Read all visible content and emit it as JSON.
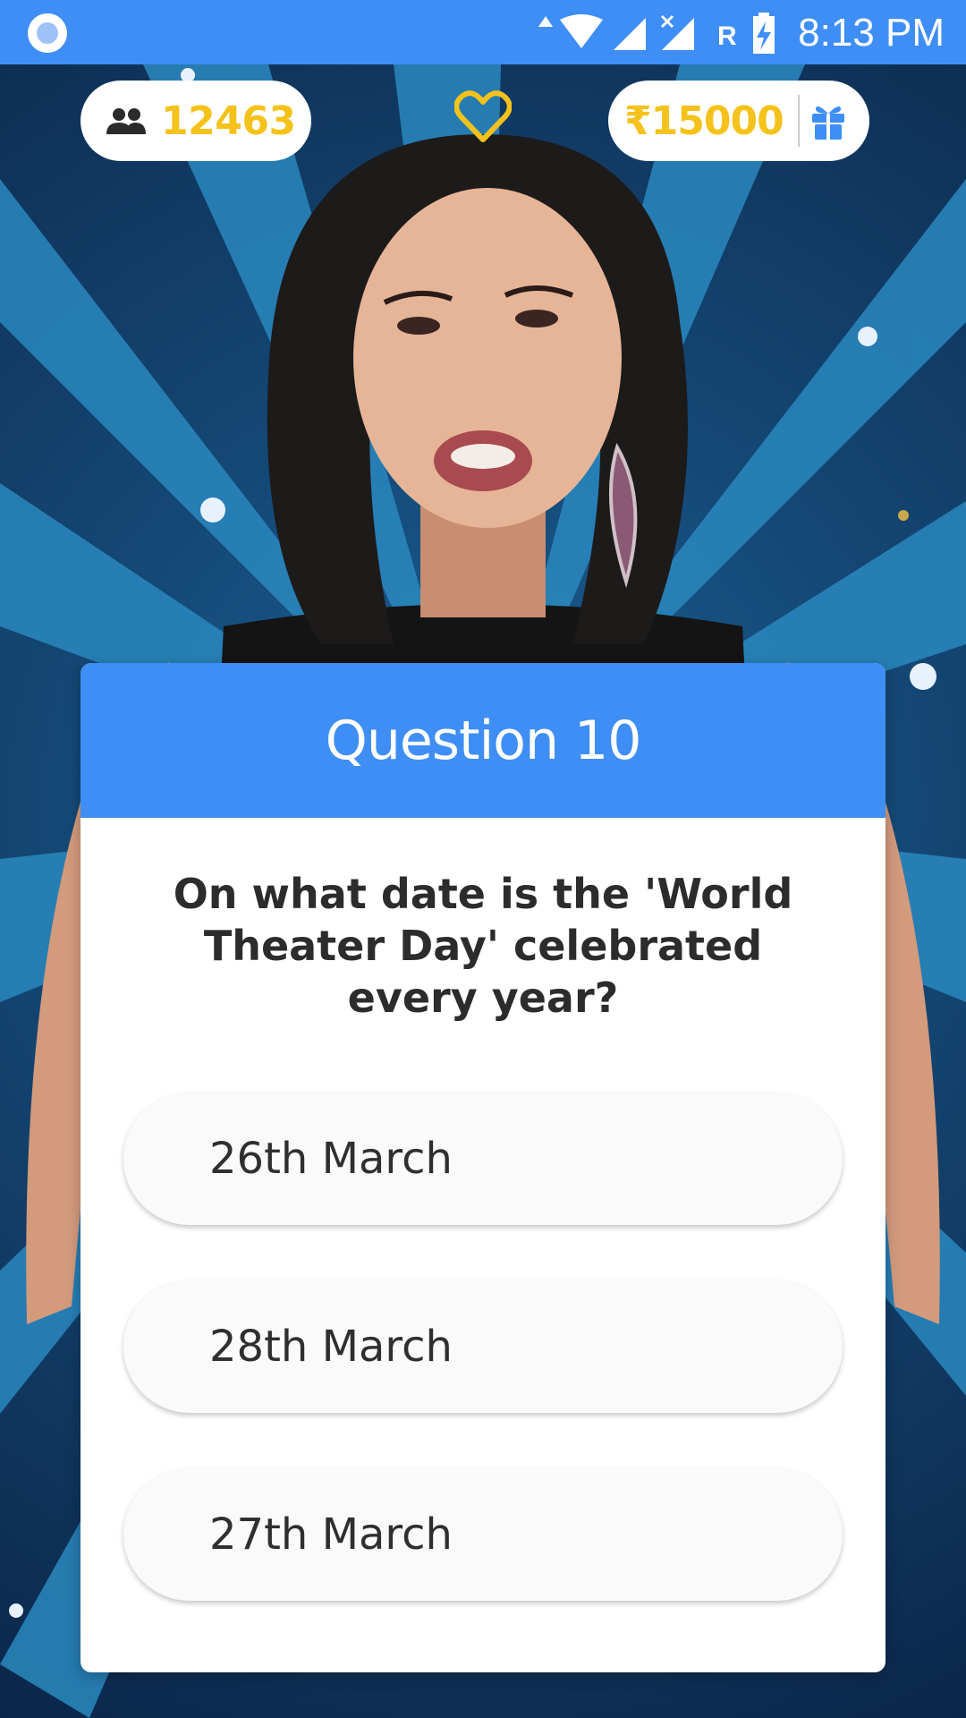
{
  "status_bar": {
    "time": "8:13 PM",
    "network_indicator": "R",
    "icons": [
      "notification-circle-icon",
      "data-arrows-icon",
      "wifi-icon",
      "signal-icon",
      "signal-no-sim-icon",
      "battery-charging-icon"
    ]
  },
  "header": {
    "viewers_count": "12463",
    "viewers_icon": "people-icon",
    "like_icon": "heart-icon",
    "prize_amount": "₹15000",
    "prize_icon": "gift-icon"
  },
  "question": {
    "title": "Question 10",
    "text": "On what date is the 'World Theater Day' celebrated every year?",
    "options": [
      {
        "label": "26th March"
      },
      {
        "label": "28th March"
      },
      {
        "label": "27th March"
      }
    ]
  },
  "colors": {
    "accent_blue": "#3f8ef5",
    "gold": "#f5c21b",
    "text_dark": "#2c2c2c",
    "card_bg": "#ffffff"
  }
}
